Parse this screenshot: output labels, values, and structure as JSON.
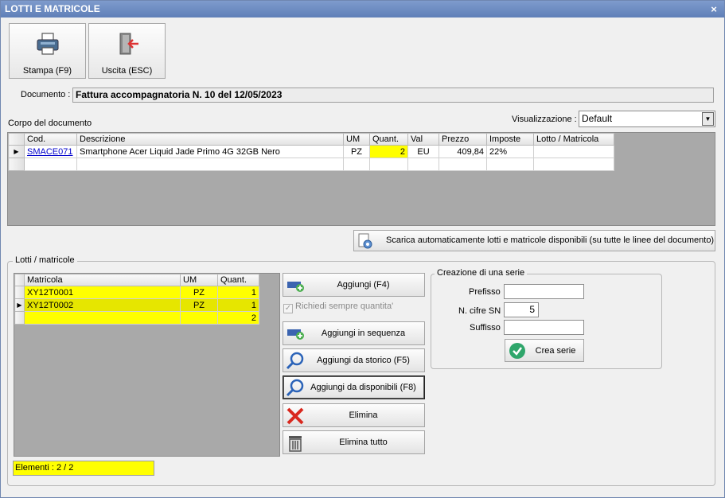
{
  "window": {
    "title": "LOTTI E MATRICOLE",
    "close_glyph": "×"
  },
  "toolbar": {
    "print": {
      "label": "Stampa (F9)",
      "icon": "printer-icon"
    },
    "exit": {
      "label": "Uscita (ESC)",
      "icon": "exit-door-icon"
    }
  },
  "document": {
    "label": "Documento :",
    "value": "Fattura accompagnatoria N. 10 del 12/05/2023"
  },
  "view": {
    "label": "Visualizzazione :",
    "selected": "Default"
  },
  "body_section": {
    "label": "Corpo del documento",
    "columns": [
      "Cod.",
      "Descrizione",
      "UM",
      "Quant.",
      "Val",
      "Prezzo",
      "Imposte",
      "Lotto / Matricola"
    ],
    "rows": [
      {
        "cod": "SMACE071",
        "descrizione": "Smartphone Acer Liquid Jade Primo 4G 32GB Nero",
        "um": "PZ",
        "quant": "2",
        "val": "EU",
        "prezzo": "409,84",
        "imposte": "22%",
        "lotto": ""
      }
    ]
  },
  "auto_download_button": {
    "label": "Scarica automaticamente lotti e matricole disponibili (su tutte le linee del documento)"
  },
  "lots_section": {
    "title": "Lotti / matricole",
    "columns": [
      "Matricola",
      "UM",
      "Quant."
    ],
    "rows": [
      {
        "matricola": "XY12T0001",
        "um": "PZ",
        "quant": "1"
      },
      {
        "matricola": "XY12T0002",
        "um": "PZ",
        "quant": "1"
      },
      {
        "matricola": "",
        "um": "",
        "quant": "2"
      }
    ],
    "status": "Elementi : 2 / 2"
  },
  "actions": {
    "add": "Aggiungi (F4)",
    "always_ask_qty": "Richiedi sempre quantita'",
    "add_sequence": "Aggiungi in sequenza",
    "add_history": "Aggiungi da storico (F5)",
    "add_available": "Aggiungi da disponibili (F8)",
    "delete": "Elimina",
    "delete_all": "Elimina tutto"
  },
  "series": {
    "title": "Creazione di una serie",
    "prefix_label": "Prefisso",
    "prefix_value": "",
    "digits_label": "N. cifre SN",
    "digits_value": "5",
    "suffix_label": "Suffisso",
    "suffix_value": "",
    "create_label": "Crea serie"
  },
  "colors": {
    "highlight": "#ffff00",
    "titlebar": "#6f8cc2",
    "link": "#0000cc"
  }
}
